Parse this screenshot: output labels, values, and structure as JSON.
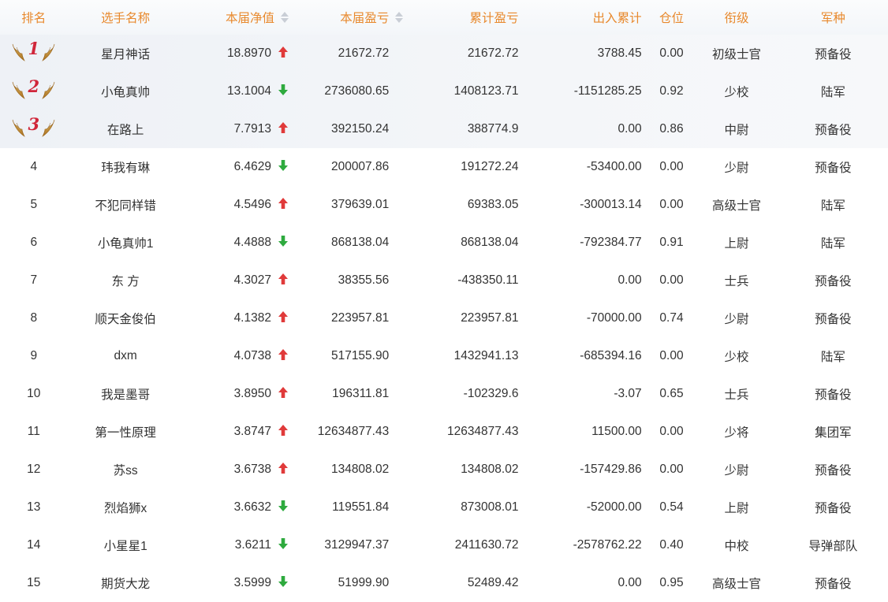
{
  "headers": {
    "rank": "排名",
    "name": "选手名称",
    "nav": "本届净值",
    "profit": "本届盈亏",
    "cum_profit": "累计盈亏",
    "net_flow": "出入累计",
    "position": "仓位",
    "grade": "衔级",
    "arm": "军种"
  },
  "colors": {
    "header_text": "#e8892d",
    "up": "#e03a3a",
    "down": "#2eaa3e",
    "medal_number": "#d0263a"
  },
  "rows": [
    {
      "rank": "1",
      "name": "星月神话",
      "nav": "18.8970",
      "trend": "up",
      "profit": "21672.72",
      "cum": "21672.72",
      "flow": "3788.45",
      "pos": "0.00",
      "grade": "初级士官",
      "arm": "预备役"
    },
    {
      "rank": "2",
      "name": "小龟真帅",
      "nav": "13.1004",
      "trend": "down",
      "profit": "2736080.65",
      "cum": "1408123.71",
      "flow": "-1151285.25",
      "pos": "0.92",
      "grade": "少校",
      "arm": "陆军"
    },
    {
      "rank": "3",
      "name": "在路上",
      "nav": "7.7913",
      "trend": "up",
      "profit": "392150.24",
      "cum": "388774.9",
      "flow": "0.00",
      "pos": "0.86",
      "grade": "中尉",
      "arm": "预备役"
    },
    {
      "rank": "4",
      "name": "玮我有琳",
      "nav": "6.4629",
      "trend": "down",
      "profit": "200007.86",
      "cum": "191272.24",
      "flow": "-53400.00",
      "pos": "0.00",
      "grade": "少尉",
      "arm": "预备役"
    },
    {
      "rank": "5",
      "name": "不犯同样错",
      "nav": "4.5496",
      "trend": "up",
      "profit": "379639.01",
      "cum": "69383.05",
      "flow": "-300013.14",
      "pos": "0.00",
      "grade": "高级士官",
      "arm": "陆军"
    },
    {
      "rank": "6",
      "name": "小龟真帅1",
      "nav": "4.4888",
      "trend": "down",
      "profit": "868138.04",
      "cum": "868138.04",
      "flow": "-792384.77",
      "pos": "0.91",
      "grade": "上尉",
      "arm": "陆军"
    },
    {
      "rank": "7",
      "name": "东 方",
      "nav": "4.3027",
      "trend": "up",
      "profit": "38355.56",
      "cum": "-438350.11",
      "flow": "0.00",
      "pos": "0.00",
      "grade": "士兵",
      "arm": "预备役"
    },
    {
      "rank": "8",
      "name": "顺天金俊伯",
      "nav": "4.1382",
      "trend": "up",
      "profit": "223957.81",
      "cum": "223957.81",
      "flow": "-70000.00",
      "pos": "0.74",
      "grade": "少尉",
      "arm": "预备役"
    },
    {
      "rank": "9",
      "name": "dxm",
      "nav": "4.0738",
      "trend": "up",
      "profit": "517155.90",
      "cum": "1432941.13",
      "flow": "-685394.16",
      "pos": "0.00",
      "grade": "少校",
      "arm": "陆军"
    },
    {
      "rank": "10",
      "name": "我是墨哥",
      "nav": "3.8950",
      "trend": "up",
      "profit": "196311.81",
      "cum": "-102329.6",
      "flow": "-3.07",
      "pos": "0.65",
      "grade": "士兵",
      "arm": "预备役"
    },
    {
      "rank": "11",
      "name": "第一性原理",
      "nav": "3.8747",
      "trend": "up",
      "profit": "12634877.43",
      "cum": "12634877.43",
      "flow": "11500.00",
      "pos": "0.00",
      "grade": "少将",
      "arm": "集团军"
    },
    {
      "rank": "12",
      "name": "苏ss",
      "nav": "3.6738",
      "trend": "up",
      "profit": "134808.02",
      "cum": "134808.02",
      "flow": "-157429.86",
      "pos": "0.00",
      "grade": "少尉",
      "arm": "预备役"
    },
    {
      "rank": "13",
      "name": "烈焰狮x",
      "nav": "3.6632",
      "trend": "down",
      "profit": "119551.84",
      "cum": "873008.01",
      "flow": "-52000.00",
      "pos": "0.54",
      "grade": "上尉",
      "arm": "预备役"
    },
    {
      "rank": "14",
      "name": "小星星1",
      "nav": "3.6211",
      "trend": "down",
      "profit": "3129947.37",
      "cum": "2411630.72",
      "flow": "-2578762.22",
      "pos": "0.40",
      "grade": "中校",
      "arm": "导弹部队"
    },
    {
      "rank": "15",
      "name": "期货大龙",
      "nav": "3.5999",
      "trend": "down",
      "profit": "51999.90",
      "cum": "52489.42",
      "flow": "0.00",
      "pos": "0.95",
      "grade": "高级士官",
      "arm": "预备役"
    }
  ]
}
